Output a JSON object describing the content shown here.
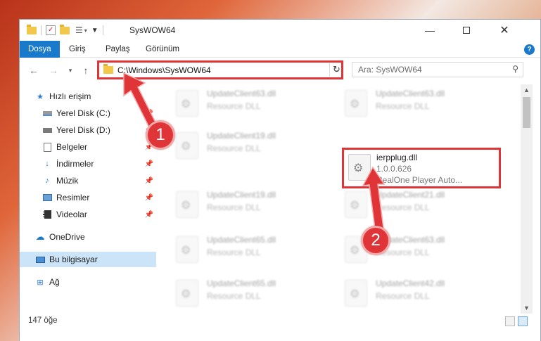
{
  "window": {
    "title": "SysWOW64"
  },
  "ribbon": {
    "tabs": [
      {
        "label": "Dosya",
        "active": true
      },
      {
        "label": "Giriş",
        "active": false
      },
      {
        "label": "Paylaş",
        "active": false
      },
      {
        "label": "Görünüm",
        "active": false
      }
    ]
  },
  "address": {
    "path": "C:\\Windows\\SysWOW64"
  },
  "search": {
    "placeholder": "Ara: SysWOW64"
  },
  "sidebar": {
    "items": [
      {
        "label": "Hızlı erişim",
        "icon": "star-icon",
        "pinned": false
      },
      {
        "label": "Yerel Disk (C:)",
        "icon": "drive-icon",
        "pinned": true
      },
      {
        "label": "Yerel Disk (D:)",
        "icon": "drive-icon",
        "pinned": true
      },
      {
        "label": "Belgeler",
        "icon": "document-icon",
        "pinned": true
      },
      {
        "label": "İndirmeler",
        "icon": "download-icon",
        "pinned": true
      },
      {
        "label": "Müzik",
        "icon": "music-icon",
        "pinned": true
      },
      {
        "label": "Resimler",
        "icon": "picture-icon",
        "pinned": true
      },
      {
        "label": "Videolar",
        "icon": "video-icon",
        "pinned": true
      },
      {
        "label": "OneDrive",
        "icon": "cloud-icon",
        "pinned": false
      },
      {
        "label": "Bu bilgisayar",
        "icon": "computer-icon",
        "pinned": false,
        "selected": true
      },
      {
        "label": "Ağ",
        "icon": "network-icon",
        "pinned": false
      }
    ]
  },
  "files": [
    {
      "name": "UpdateClient63.dll",
      "type": "Resource DLL"
    },
    {
      "name": "UpdateClient63.dll",
      "type": "Resource DLL"
    },
    {
      "name": "UpdateClient19.dll",
      "type": "Resource DLL"
    },
    {
      "name": "ierpplug.dll",
      "type": "1.0.0.626",
      "desc": "RealOne Player Auto..."
    },
    {
      "name": "UpdateClient19.dll",
      "type": "Resource DLL"
    },
    {
      "name": "UpdateClient21.dll",
      "type": "Resource DLL"
    },
    {
      "name": "UpdateClient65.dll",
      "type": "Resource DLL"
    },
    {
      "name": "UpdateClient63.dll",
      "type": "Resource DLL"
    },
    {
      "name": "UpdateClient65.dll",
      "type": "Resource DLL"
    },
    {
      "name": "UpdateClient42.dll",
      "type": "Resource DLL"
    }
  ],
  "status": {
    "count": "147 öğe"
  },
  "annotations": {
    "badge1": "1",
    "badge2": "2"
  },
  "colors": {
    "accent": "#1979ca",
    "highlight": "#e03538",
    "selected": "#cce4f7"
  }
}
